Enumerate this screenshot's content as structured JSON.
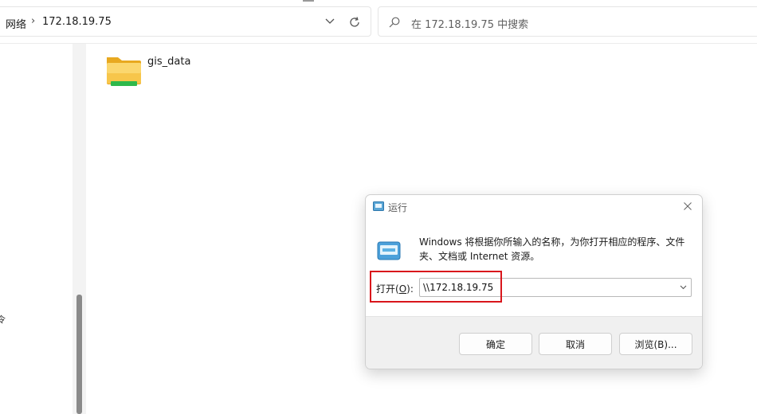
{
  "explorer": {
    "breadcrumb": [
      "网络",
      "172.18.19.75"
    ],
    "breadcrumb_sep": "›",
    "search_placeholder": "在 172.18.19.75 中搜索",
    "items": [
      {
        "name": "gis_data",
        "icon": "folder-icon"
      }
    ],
    "nav_pane_stub": "令"
  },
  "run_dialog": {
    "title": "运行",
    "description": "Windows 将根据你所输入的名称，为你打开相应的程序、文件夹、文档或 Internet 资源。",
    "open_label_prefix": "打开(",
    "open_label_key": "O",
    "open_label_suffix": "):",
    "open_value": "\\\\172.18.19.75",
    "buttons": {
      "ok": "确定",
      "cancel": "取消",
      "browse": "浏览(B)..."
    }
  },
  "colors": {
    "highlight": "#d9161c",
    "folder": "#f7c64b",
    "accent": "#0078d4"
  }
}
